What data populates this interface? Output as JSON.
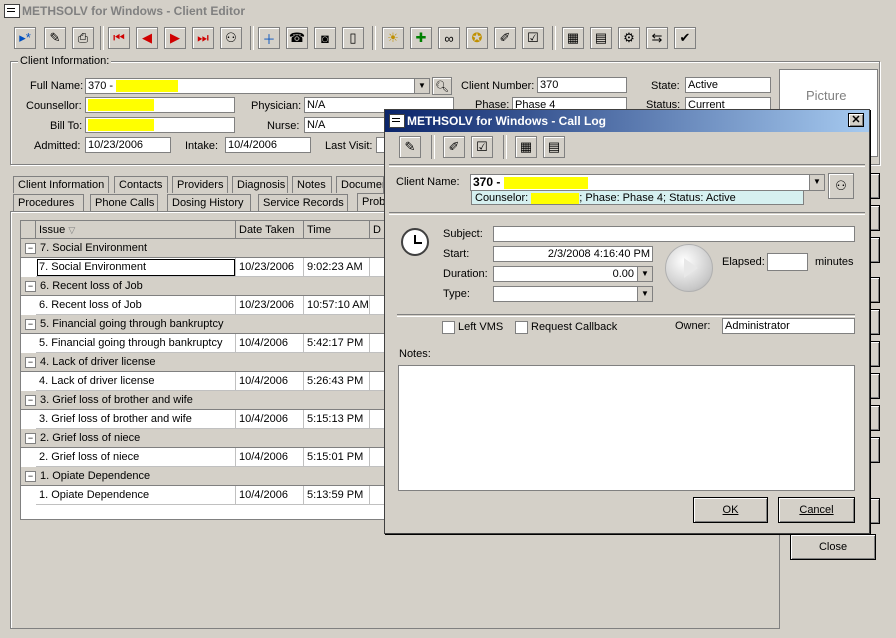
{
  "main_window": {
    "title": "METHSOLV for Windows - Client Editor",
    "client_info_label": "Client Information:",
    "full_name_label": "Full Name:",
    "full_name_value": "370 -",
    "counsellor_label": "Counsellor:",
    "bill_to_label": "Bill To:",
    "admitted_label": "Admitted:",
    "admitted_value": "10/23/2006",
    "physician_label": "Physician:",
    "physician_value": "N/A",
    "nurse_label": "Nurse:",
    "nurse_value": "N/A",
    "intake_label": "Intake:",
    "intake_value": "10/4/2006",
    "last_visit_label": "Last Visit:",
    "client_number_label": "Client Number:",
    "client_number_value": "370",
    "phase_label": "Phase:",
    "phase_value": "Phase 4",
    "state_label": "State:",
    "state_value": "Active",
    "status_label": "Status:",
    "status_value": "Current",
    "picture_label": "Picture",
    "close_button": "Close"
  },
  "tabs_row1": [
    "Client Information",
    "Contacts",
    "Providers",
    "Diagnosis",
    "Notes",
    "Documents"
  ],
  "tabs_row2": [
    "Procedures",
    "Phone Calls",
    "Dosing History",
    "Service Records",
    "Problems"
  ],
  "grid": {
    "columns": [
      "Issue",
      "Date Taken",
      "Time",
      "D"
    ],
    "groups": [
      {
        "group": "7. Social Environment",
        "issue": "7. Social Environment",
        "date": "10/23/2006",
        "time": "9:02:23 AM"
      },
      {
        "group": "6. Recent loss of Job",
        "issue": "6. Recent loss of Job",
        "date": "10/23/2006",
        "time": "10:57:10 AM"
      },
      {
        "group": "5. Financial going through bankruptcy",
        "issue": "5. Financial going through bankruptcy",
        "date": "10/4/2006",
        "time": "5:42:17 PM"
      },
      {
        "group": "4. Lack of driver license",
        "issue": "4. Lack of driver license",
        "date": "10/4/2006",
        "time": "5:26:43 PM"
      },
      {
        "group": "3. Grief loss of brother and wife",
        "issue": "3. Grief loss of brother and wife",
        "date": "10/4/2006",
        "time": "5:15:13 PM"
      },
      {
        "group": "2. Grief loss of niece",
        "issue": "2. Grief loss of niece",
        "date": "10/4/2006",
        "time": "5:15:01 PM"
      },
      {
        "group": "1. Opiate Dependence",
        "issue": "1. Opiate Dependence",
        "date": "10/4/2006",
        "time": "5:13:59 PM"
      }
    ]
  },
  "dialog": {
    "title": "METHSOLV for Windows - Call Log",
    "client_name_label": "Client Name:",
    "client_name_value": "370 -",
    "counsellor_prefix": "Counselor:",
    "counsellor_suffix": "; Phase: Phase 4; Status: Active",
    "subject_label": "Subject:",
    "start_label": "Start:",
    "start_value": "2/3/2008 4:16:40 PM",
    "duration_label": "Duration:",
    "duration_value": "0.00",
    "type_label": "Type:",
    "elapsed_label": "Elapsed:",
    "minutes_label": "minutes",
    "left_vms_label": "Left VMS",
    "request_callback_label": "Request Callback",
    "owner_label": "Owner:",
    "owner_value": "Administrator",
    "notes_label": "Notes:",
    "ok_button": "OK",
    "cancel_button": "Cancel"
  },
  "colors": {
    "redaction": "#ffff00",
    "dialog_title_start": "#0a246a",
    "dialog_title_end": "#a6caf0"
  }
}
